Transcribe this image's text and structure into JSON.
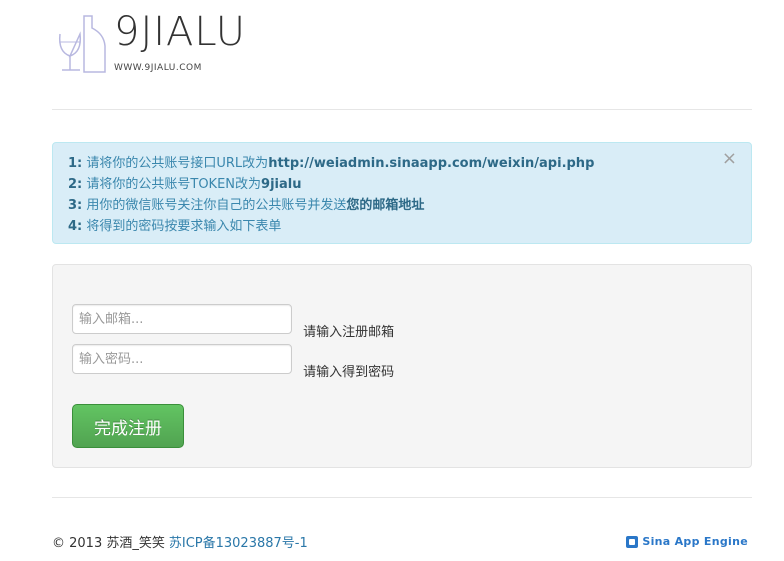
{
  "header": {
    "logo_text": "9JIALU",
    "logo_url": "WWW.9JIALU.COM"
  },
  "alert": {
    "close_glyph": "×",
    "lines": [
      {
        "num": "1:",
        "text": " 请将你的公共账号接口URL改为",
        "bold": "http://weiadmin.sinaapp.com/weixin/api.php"
      },
      {
        "num": "2:",
        "text": " 请将你的公共账号TOKEN改为",
        "bold": "9jialu"
      },
      {
        "num": "3:",
        "text": " 用你的微信账号关注你自己的公共账号并发送",
        "bold": "您的邮箱地址"
      },
      {
        "num": "4:",
        "text": " 将得到的密码按要求输入如下表单",
        "bold": ""
      }
    ]
  },
  "form": {
    "email_placeholder": "输入邮箱...",
    "email_help": "请输入注册邮箱",
    "password_placeholder": "输入密码...",
    "password_help": "请输入得到密码",
    "submit_label": "完成注册"
  },
  "footer": {
    "copyright": "© 2013 苏酒_笑笑",
    "icp_link": "苏ICP备13023887号-1",
    "sae_label": "Sina App Engine"
  },
  "colors": {
    "alert_bg": "#d9edf7",
    "alert_text": "#3a87ad",
    "button_green": "#5bb75b",
    "link": "#2a77a8"
  },
  "icons": {
    "logo": "wine-glass-bottle-icon",
    "close": "close-icon",
    "sae": "sae-logo-icon"
  }
}
